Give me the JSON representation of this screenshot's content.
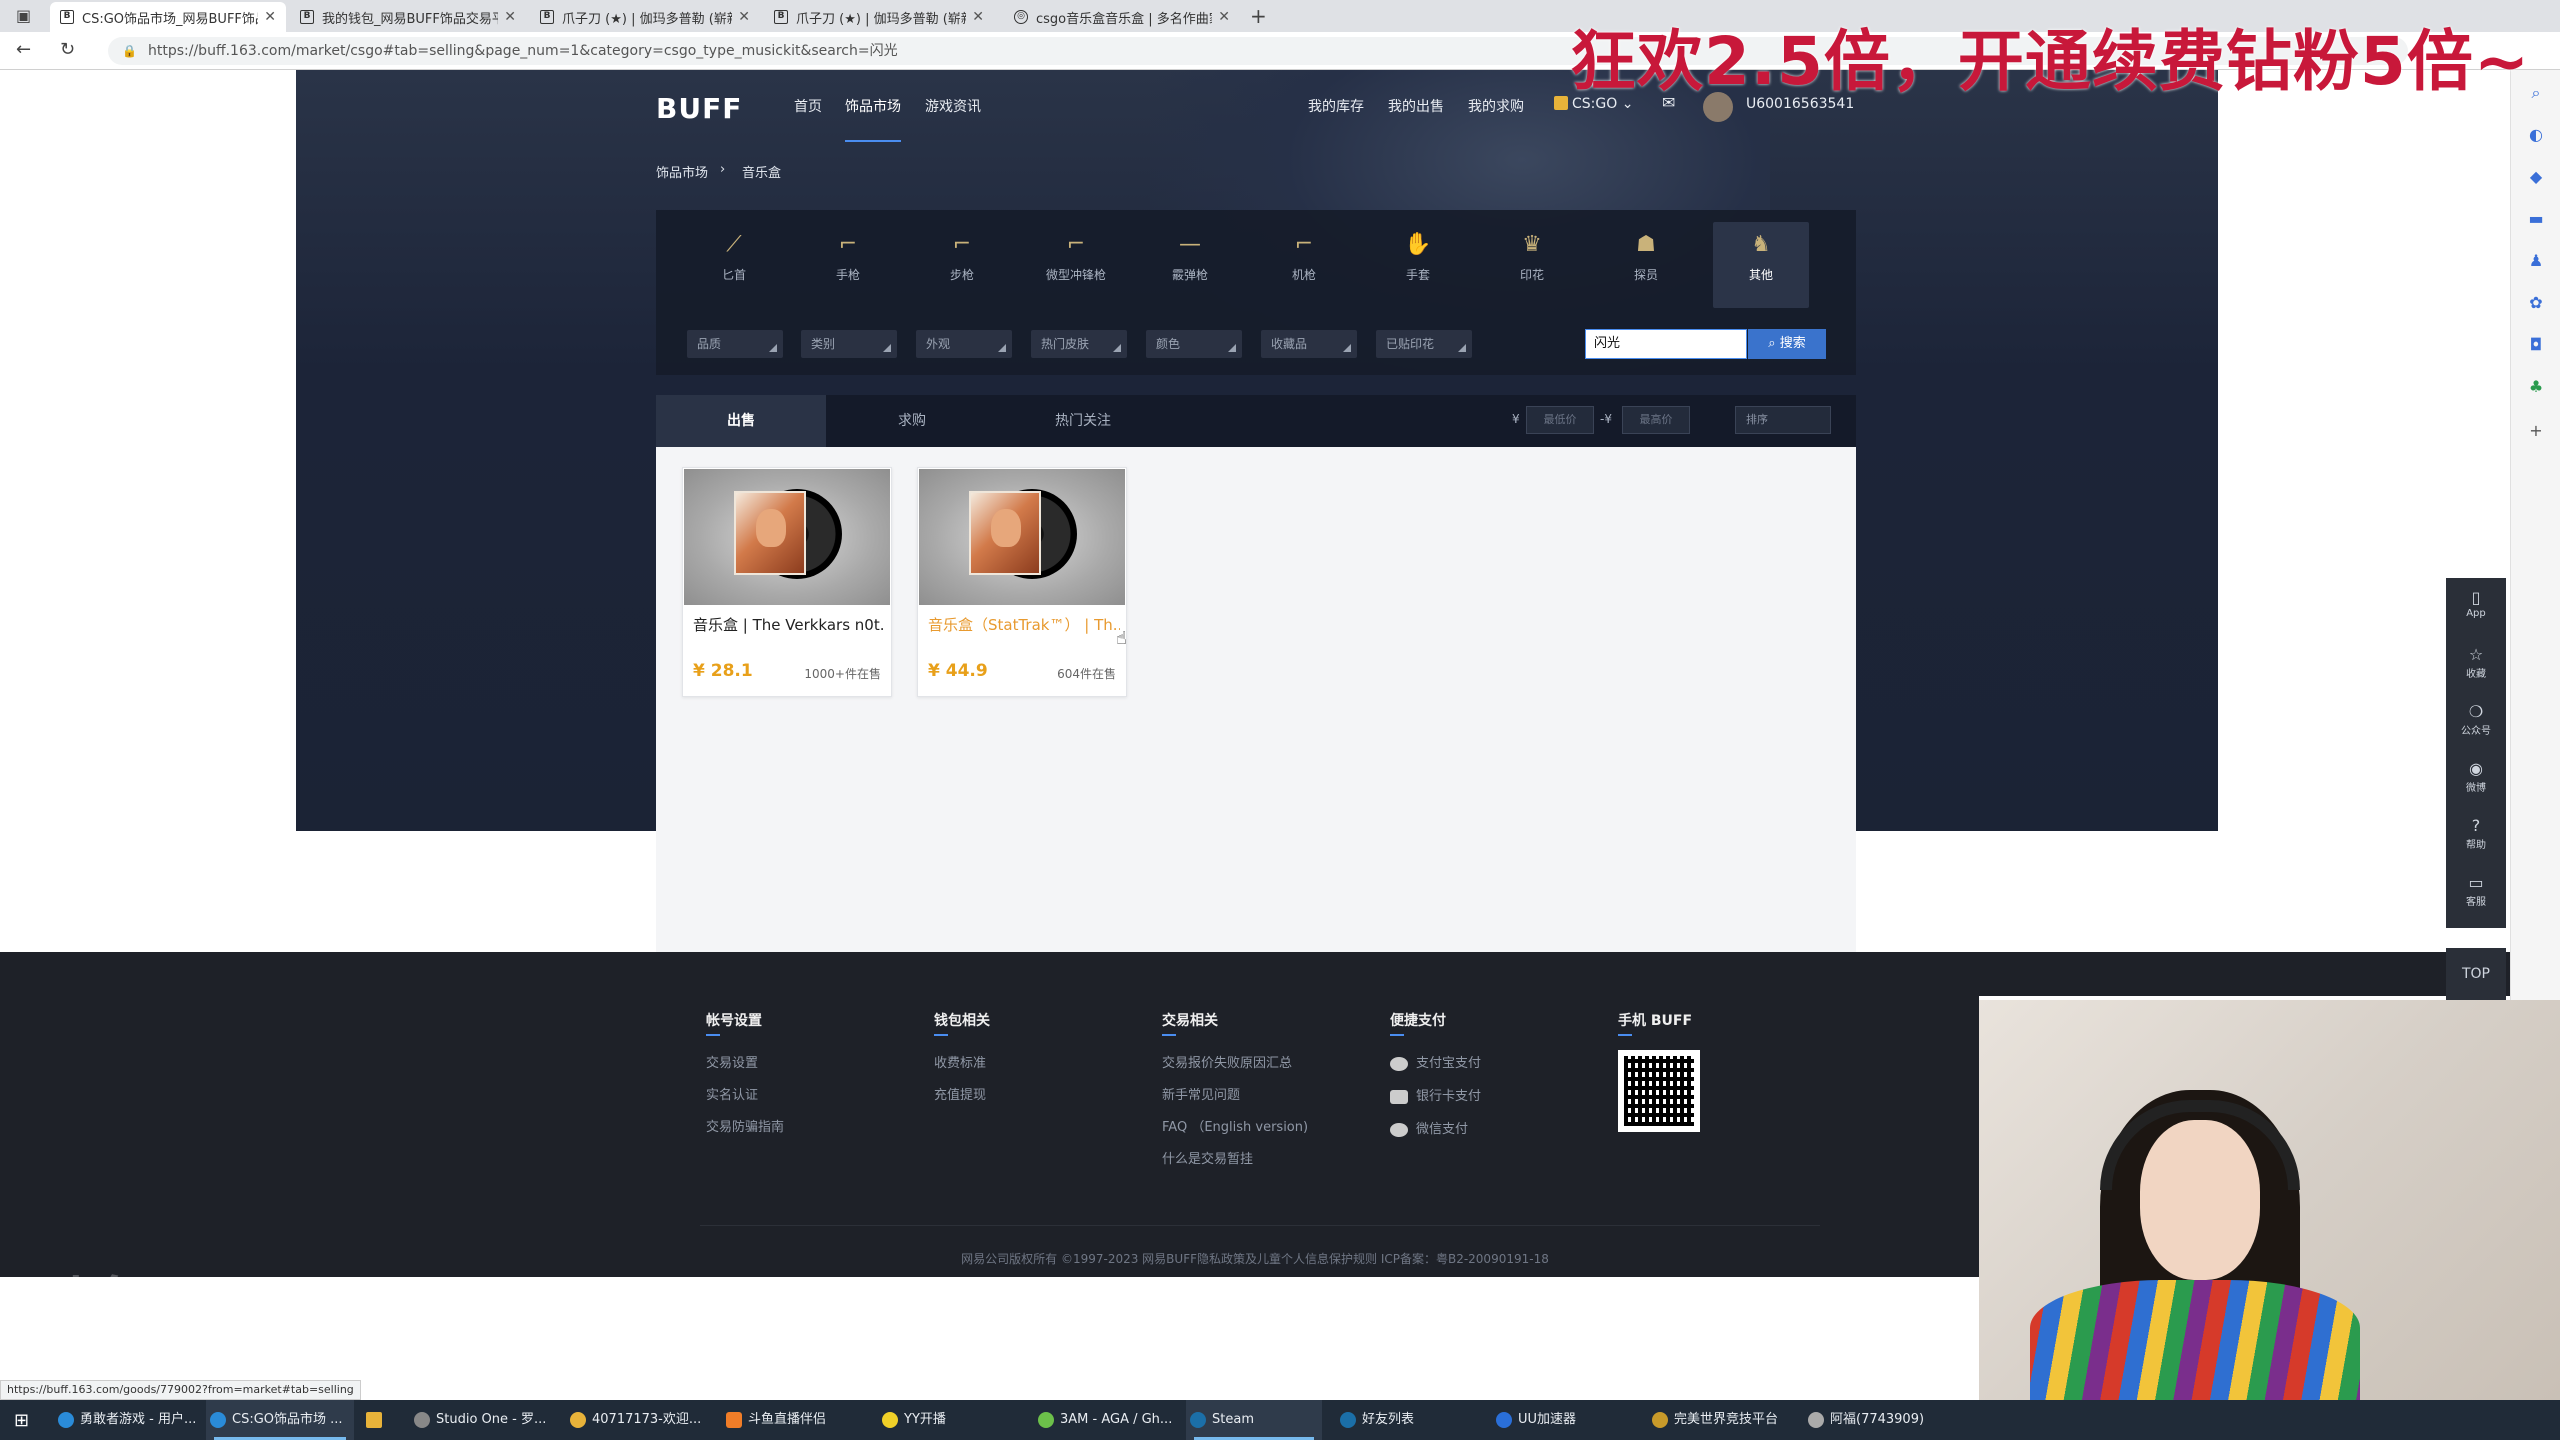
{
  "browser": {
    "tabs": [
      {
        "title": "CS:GO饰品市场_网易BUFF饰品交..."
      },
      {
        "title": "我的钱包_网易BUFF饰品交易平台"
      },
      {
        "title": "爪子刀 (★) | 伽玛多普勒 (崭新..."
      },
      {
        "title": "爪子刀 (★) | 伽玛多普勒 (崭新..."
      },
      {
        "title": "csgo音乐盒音乐盒 | 多名作曲家..."
      }
    ],
    "url": "https://buff.163.com/market/csgo#tab=selling&page_num=1&category=csgo_type_musickit&search=闪光"
  },
  "promo_overlay": "狂欢2.5倍，开通续费钻粉5倍~",
  "site": {
    "logo": "BUFF",
    "nav": [
      "首页",
      "饰品市场",
      "游戏资讯"
    ],
    "user_nav": [
      "我的库存",
      "我的出售",
      "我的求购"
    ],
    "game": "CS:GO",
    "username": "U60016563541",
    "breadcrumb": [
      "饰品市场",
      "音乐盒"
    ]
  },
  "categories": [
    {
      "label": "匕首",
      "icon": "knife-icon"
    },
    {
      "label": "手枪",
      "icon": "pistol-icon"
    },
    {
      "label": "步枪",
      "icon": "rifle-icon"
    },
    {
      "label": "微型冲锋枪",
      "icon": "smg-icon"
    },
    {
      "label": "霰弹枪",
      "icon": "shotgun-icon"
    },
    {
      "label": "机枪",
      "icon": "machinegun-icon"
    },
    {
      "label": "手套",
      "icon": "glove-icon"
    },
    {
      "label": "印花",
      "icon": "sticker-icon"
    },
    {
      "label": "探员",
      "icon": "agent-icon"
    },
    {
      "label": "其他",
      "icon": "other-icon"
    }
  ],
  "filters": [
    "品质",
    "类别",
    "外观",
    "热门皮肤",
    "颜色",
    "收藏品",
    "已贴印花"
  ],
  "search": {
    "value": "闪光",
    "button": "搜索"
  },
  "list_tabs": [
    "出售",
    "求购",
    "热门关注"
  ],
  "price_filter": {
    "currency": "¥",
    "min_placeholder": "最低价",
    "separator": "-¥",
    "max_placeholder": "最高价",
    "sort": "排序"
  },
  "items": [
    {
      "name": "音乐盒 | The Verkkars n0t...",
      "price": "¥ 28.1",
      "count": "1000+件在售",
      "stattrak": false
    },
    {
      "name": "音乐盒（StatTrak™） | Th...",
      "price": "¥ 44.9",
      "count": "604件在售",
      "stattrak": true
    }
  ],
  "footer": {
    "columns": [
      {
        "title": "帐号设置",
        "links": [
          "交易设置",
          "实名认证",
          "交易防骗指南"
        ]
      },
      {
        "title": "钱包相关",
        "links": [
          "收费标准",
          "充值提现"
        ]
      },
      {
        "title": "交易相关",
        "links": [
          "交易报价失败原因汇总",
          "新手常见问题",
          "FAQ （English version)",
          "什么是交易暂挂"
        ]
      },
      {
        "title": "便捷支付",
        "links": [
          "支付宝支付",
          "银行卡支付",
          "微信支付"
        ]
      },
      {
        "title": "手机 BUFF",
        "links": []
      }
    ],
    "copyright": "网易公司版权所有 ©1997-2023 网易BUFF隐私政策及儿童个人信息保护规则 ICP备案：粤B2-20090191-18"
  },
  "float_panel": [
    "App",
    "收藏",
    "公众号",
    "微博",
    "帮助",
    "客服"
  ],
  "top_button": "TOP",
  "status_link": "https://buff.163.com/goods/779002?from=market#tab=selling",
  "watermark": {
    "brand": "斗鱼",
    "sub": "房间号"
  },
  "taskbar": [
    {
      "label": "勇敢者游戏 - 用户...",
      "color": "#2a8bd8"
    },
    {
      "label": "CS:GO饰品市场 ...",
      "color": "#2a8bd8"
    },
    {
      "label": "",
      "color": "#e8b33a"
    },
    {
      "label": "Studio One - 罗...",
      "color": "#888888"
    },
    {
      "label": "40717173-欢迎...",
      "color": "#e8b33a"
    },
    {
      "label": "斗鱼直播伴侣",
      "color": "#f07d28"
    },
    {
      "label": "YY开播",
      "color": "#f0d028"
    },
    {
      "label": "3AM - AGA / Gh...",
      "color": "#6cc04a"
    },
    {
      "label": "Steam",
      "color": "#1b6fa8"
    },
    {
      "label": "好友列表",
      "color": "#1b6fa8"
    },
    {
      "label": "UU加速器",
      "color": "#2a6fd8"
    },
    {
      "label": "完美世界竞技平台",
      "color": "#c89a2a"
    },
    {
      "label": "阿福(7743909)",
      "color": "#aaaaaa"
    }
  ]
}
